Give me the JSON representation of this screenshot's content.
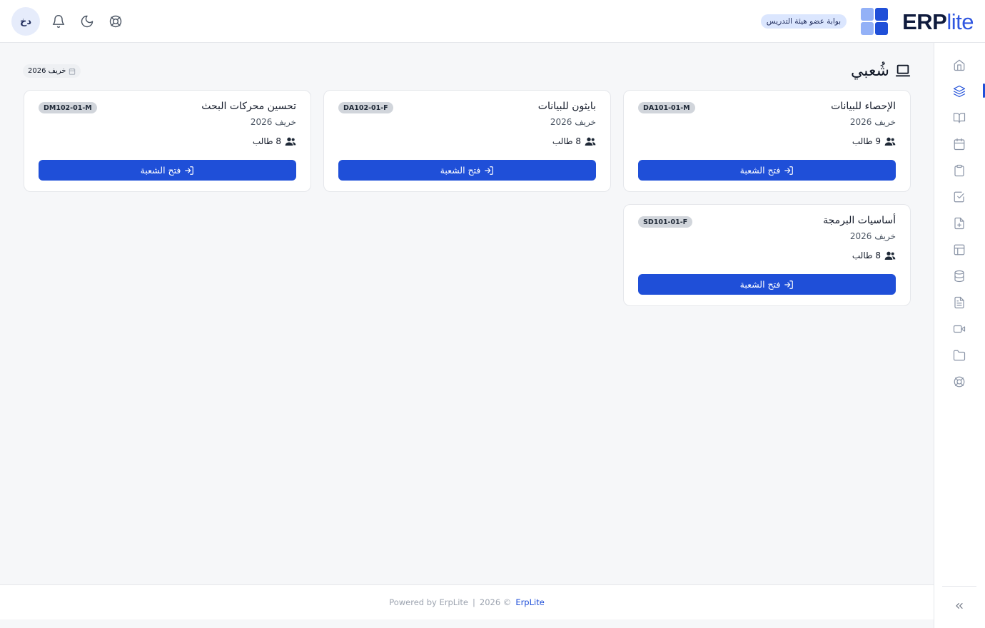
{
  "header": {
    "brand_erp": "ERP",
    "brand_lite": "lite",
    "portal_badge": "بوابة عضو هيئة التدريس",
    "avatar_initials": "دخ"
  },
  "page": {
    "title": "شُعبي",
    "term_badge": "خريف 2026"
  },
  "sections": [
    {
      "title": "الإحصاء للبيانات",
      "term": "خريف 2026",
      "students": "9 طالب",
      "code": "DA101-01-M",
      "button": "فتح الشعبة"
    },
    {
      "title": "بايثون للبيانات",
      "term": "خريف 2026",
      "students": "8 طالب",
      "code": "DA102-01-F",
      "button": "فتح الشعبة"
    },
    {
      "title": "تحسين محركات البحث",
      "term": "خريف 2026",
      "students": "8 طالب",
      "code": "DM102-01-M",
      "button": "فتح الشعبة"
    },
    {
      "title": "أساسيات البرمجة",
      "term": "خريف 2026",
      "students": "8 طالب",
      "code": "SD101-01-F",
      "button": "فتح الشعبة"
    }
  ],
  "sidebar": {
    "items": [
      {
        "icon": "home-icon"
      },
      {
        "icon": "layers-icon",
        "active": true
      },
      {
        "icon": "book-open-icon"
      },
      {
        "icon": "calendar-icon"
      },
      {
        "icon": "clipboard-icon"
      },
      {
        "icon": "check-square-icon"
      },
      {
        "icon": "file-plus-icon"
      },
      {
        "icon": "layout-icon"
      },
      {
        "icon": "database-icon"
      },
      {
        "icon": "file-text-icon"
      },
      {
        "icon": "video-icon"
      },
      {
        "icon": "folder-icon"
      },
      {
        "icon": "lifebuoy-icon"
      }
    ]
  },
  "footer": {
    "powered": "Powered by ErpLite",
    "separator": "|",
    "copyright": "2026 ©",
    "brand": "ErpLite"
  },
  "colors": {
    "primary": "#1f4fd8",
    "brand_dark": "#0f1b3d",
    "brand_light": "#93b1f7",
    "background": "#f6f7f9"
  }
}
